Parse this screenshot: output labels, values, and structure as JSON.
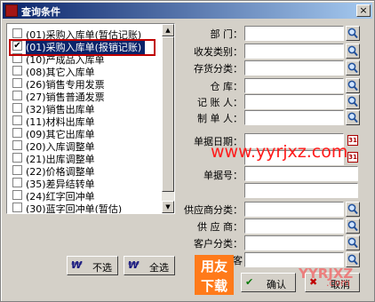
{
  "window": {
    "title": "查询条件",
    "close_label": "×"
  },
  "list": {
    "items": [
      {
        "label": "(01)采购入库单(暂估记账)",
        "checked": false,
        "selected": false
      },
      {
        "label": "(01)采购入库单(报销记账)",
        "checked": true,
        "selected": true
      },
      {
        "label": "(10)产成品入库单",
        "checked": false,
        "selected": false
      },
      {
        "label": "(08)其它入库单",
        "checked": false,
        "selected": false
      },
      {
        "label": "(26)销售专用发票",
        "checked": false,
        "selected": false
      },
      {
        "label": "(27)销售普通发票",
        "checked": false,
        "selected": false
      },
      {
        "label": "(32)销售出库单",
        "checked": false,
        "selected": false
      },
      {
        "label": "(11)材料出库单",
        "checked": false,
        "selected": false
      },
      {
        "label": "(09)其它出库单",
        "checked": false,
        "selected": false
      },
      {
        "label": "(20)入库调整单",
        "checked": false,
        "selected": false
      },
      {
        "label": "(21)出库调整单",
        "checked": false,
        "selected": false
      },
      {
        "label": "(22)价格调整单",
        "checked": false,
        "selected": false
      },
      {
        "label": "(35)差异结转单",
        "checked": false,
        "selected": false
      },
      {
        "label": "(24)红字回冲单",
        "checked": false,
        "selected": false
      },
      {
        "label": "(30)蓝字回冲单(暂估)",
        "checked": false,
        "selected": false
      }
    ],
    "check_mark": "✔"
  },
  "buttons": {
    "deselect_all": "不选",
    "select_all": "全选",
    "confirm": "确认",
    "cancel": "取消",
    "deselect_icon_text": "ᛞ",
    "select_icon_text": "ᛞ"
  },
  "fields": {
    "department": "部    门：",
    "dispatch_type": "收发类别：",
    "inventory_class": "存货分类：",
    "warehouse": "仓    库：",
    "bookkeeper": "记 账 人：",
    "maker": "制 单 人：",
    "doc_date": "单据日期：",
    "doc_no": "单据号：",
    "supplier_class": "供应商分类：",
    "supplier": "供 应 商：",
    "customer_class": "客户分类：",
    "customer": "客"
  },
  "watermark": {
    "url": "www.yyrjxz.com",
    "logo_top": "用友",
    "logo_bottom": "下载",
    "yy": "YYRJXZ",
    "com": ".com"
  },
  "colors": {
    "title_bar": "#0a246a",
    "selection": "#0a246a",
    "highlight_box": "#c00000",
    "watermark": "#ff1a1a"
  }
}
